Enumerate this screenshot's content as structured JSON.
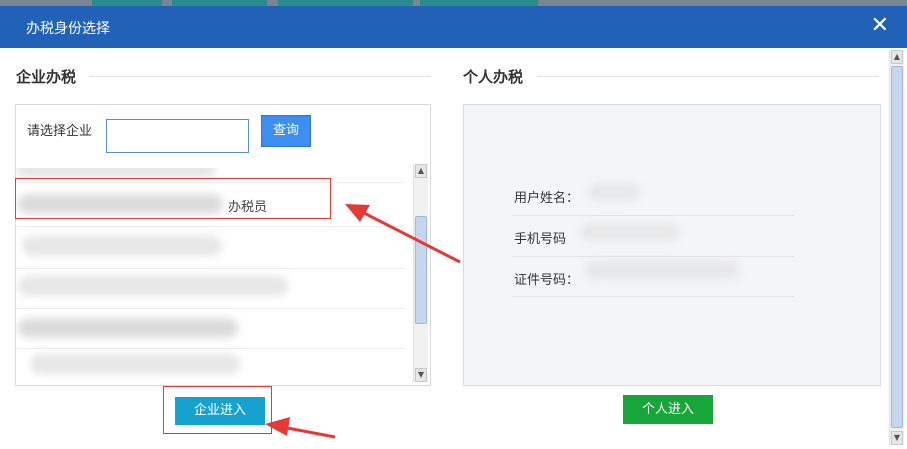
{
  "dialog": {
    "title": "办税身份选择",
    "close_icon": "close-icon"
  },
  "enterprise": {
    "heading": "企业办税",
    "select_label": "请选择企业",
    "select_value": "",
    "query_label": "查询",
    "highlighted_row_suffix": "办税员",
    "enter_label": "企业进入"
  },
  "personal": {
    "heading": "个人办税",
    "name_label": "用户姓名：",
    "phone_label": "手机号码",
    "id_label": "证件号码：",
    "enter_label": "个人进入"
  },
  "colors": {
    "title_bar": "#2261b8",
    "query_button": "#3d8ef0",
    "enterprise_button": "#16a2cf",
    "personal_button": "#17a63a",
    "annotation_red": "#e53935"
  }
}
